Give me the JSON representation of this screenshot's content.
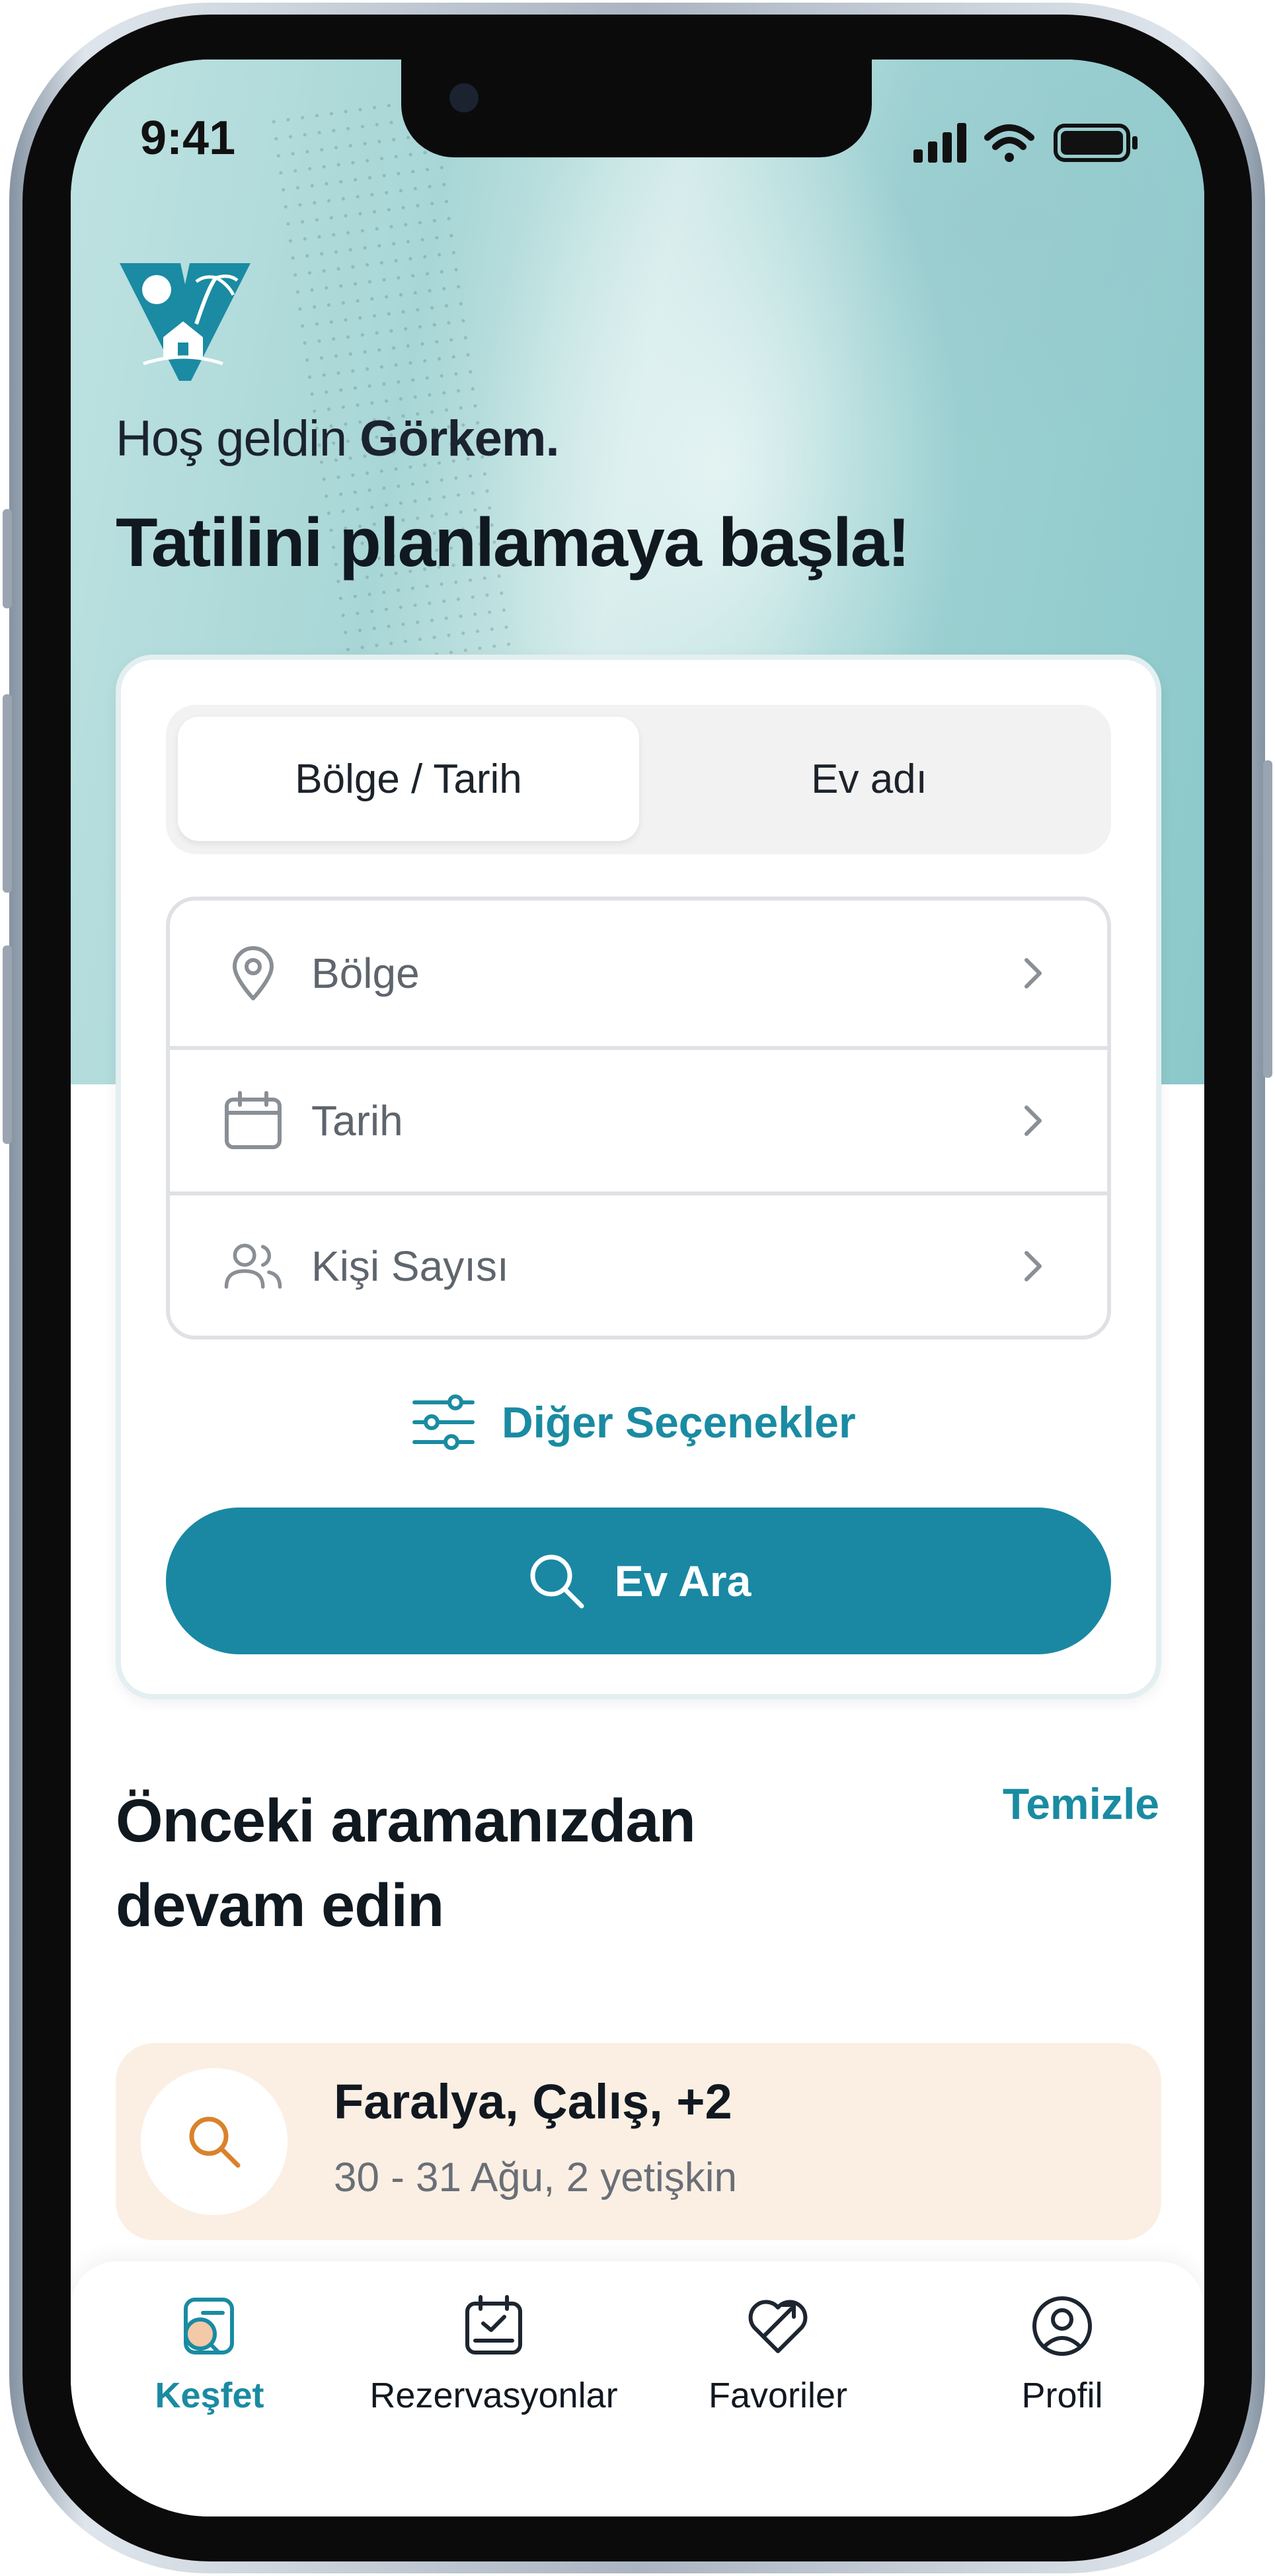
{
  "status_bar": {
    "time": "9:41",
    "icons": [
      "cellular-signal-icon",
      "wifi-icon",
      "battery-icon"
    ]
  },
  "hero": {
    "greeting_prefix": "Hoş geldin",
    "user_name": "Görkem.",
    "headline": "Tatilini planlamaya başla!"
  },
  "search_card": {
    "tabs": [
      {
        "label": "Bölge / Tarih",
        "active": true
      },
      {
        "label": "Ev adı",
        "active": false
      }
    ],
    "fields": [
      {
        "label": "Bölge",
        "icon": "location-pin-icon"
      },
      {
        "label": "Tarih",
        "icon": "calendar-icon"
      },
      {
        "label": "Kişi Sayısı",
        "icon": "people-icon"
      }
    ],
    "more_options_label": "Diğer Seçenekler",
    "search_button_label": "Ev Ara"
  },
  "previous_searches": {
    "title": "Önceki aramanızdan devam edin",
    "clear_label": "Temizle",
    "items": [
      {
        "title": "Faralya, Çalış, +2",
        "subtitle": "30 - 31 Ağu, 2 yetişkin",
        "icon": "search-icon"
      }
    ]
  },
  "tab_bar": {
    "tabs": [
      {
        "label": "Keşfet",
        "icon": "explore-icon",
        "active": true
      },
      {
        "label": "Rezervasyonlar",
        "icon": "calendar-check-icon",
        "active": false
      },
      {
        "label": "Favoriler",
        "icon": "heart-icon",
        "active": false
      },
      {
        "label": "Profil",
        "icon": "user-circle-icon",
        "active": false
      }
    ]
  },
  "colors": {
    "accent": "#1a88a3",
    "accent_text": "#1a8ba2",
    "recent_card_bg": "#fbefe4",
    "recent_icon": "#d9822b",
    "hero_teal": "#a8d6d6"
  }
}
